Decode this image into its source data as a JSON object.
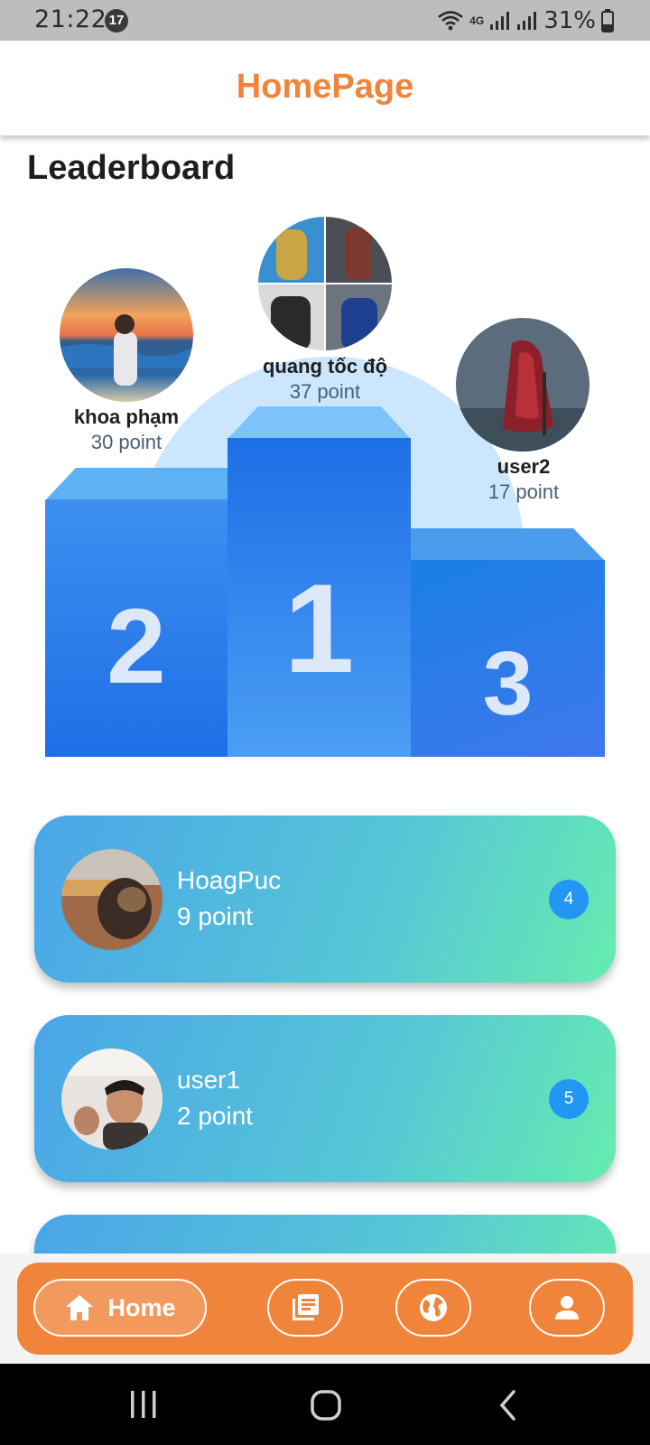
{
  "status_bar": {
    "time": "21:22",
    "notification_count": "17",
    "network": "4G",
    "battery": "31%"
  },
  "app_bar": {
    "title": "HomePage"
  },
  "leaderboard": {
    "title": "Leaderboard",
    "podium": [
      {
        "rank": "1",
        "name": "quang tốc độ",
        "points": "37 point",
        "avatar": "avatar-collage-icon"
      },
      {
        "rank": "2",
        "name": "khoa phạm",
        "points": "30 point",
        "avatar": "avatar-beach-photo"
      },
      {
        "rank": "3",
        "name": "user2",
        "points": "17 point",
        "avatar": "avatar-red-cloak-art"
      }
    ],
    "list": [
      {
        "rank": "4",
        "name": "HoagPuc",
        "points": "9 point",
        "avatar": "avatar-cat-photo"
      },
      {
        "rank": "5",
        "name": "user1",
        "points": "2 point",
        "avatar": "avatar-person-photo"
      }
    ]
  },
  "bottom_nav": {
    "items": [
      {
        "label": "Home",
        "icon": "home-icon",
        "active": true
      },
      {
        "label": "",
        "icon": "news-icon",
        "active": false
      },
      {
        "label": "",
        "icon": "globe-icon",
        "active": false
      },
      {
        "label": "",
        "icon": "person-icon",
        "active": false
      }
    ]
  },
  "colors": {
    "accent": "#f0843a",
    "podium_blue": "#2a7de8",
    "rank_badge": "#2196f3",
    "card_start": "#4aa5e8",
    "card_end": "#66ecb0"
  }
}
